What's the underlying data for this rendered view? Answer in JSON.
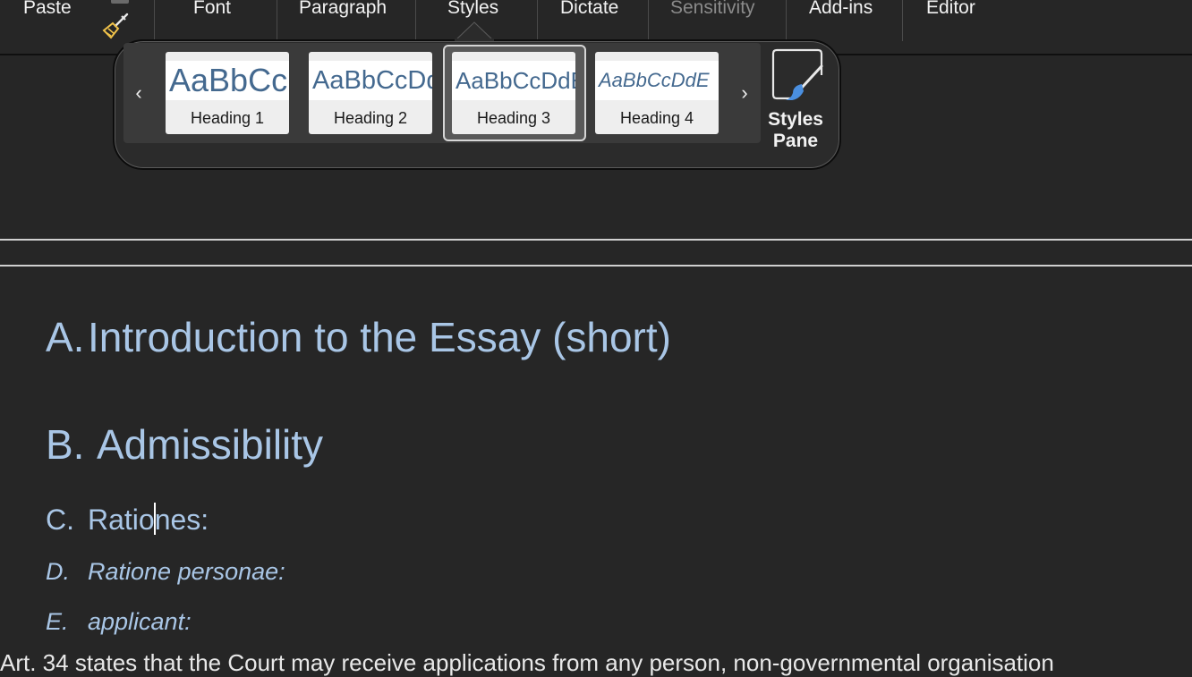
{
  "ribbon": {
    "paste": "Paste",
    "font": "Font",
    "paragraph": "Paragraph",
    "styles": "Styles",
    "dictate": "Dictate",
    "sensitivity": "Sensitivity",
    "addins": "Add-ins",
    "editor": "Editor",
    "format_painter_icon": "paintbrush-icon"
  },
  "styles_gallery": {
    "prev_arrow": "‹",
    "next_arrow": "›",
    "items": [
      {
        "preview": "AaBbCcDdE",
        "name": "Heading 1"
      },
      {
        "preview": "AaBbCcDdE",
        "name": "Heading 2"
      },
      {
        "preview": "AaBbCcDdE",
        "name": "Heading 3",
        "selected": true
      },
      {
        "preview": "AaBbCcDdE",
        "name": "Heading 4"
      }
    ],
    "styles_pane_line1": "Styles",
    "styles_pane_line2": "Pane",
    "styles_pane_icon": "paintbrush-pane-icon"
  },
  "document": {
    "heading_a_marker": "A.",
    "heading_a_text": "Introduction to the Essay (short)",
    "heading_b_marker": "B.",
    "heading_b_text": "Admissibility",
    "heading_c_marker": "C.",
    "heading_c_text_before_cursor": "Ratio",
    "heading_c_text_after_cursor": "nes:",
    "heading_d_marker": "D.",
    "heading_d_text": "Ratione personae:",
    "heading_e_marker": "E.",
    "heading_e_text": "applicant:",
    "body_partial": "Art. 34  states that the Court may receive applications from any person, non-governmental organisation"
  },
  "colors": {
    "heading_text": "#a9c6e6",
    "preview_text": "#44698f",
    "background": "#262626"
  }
}
